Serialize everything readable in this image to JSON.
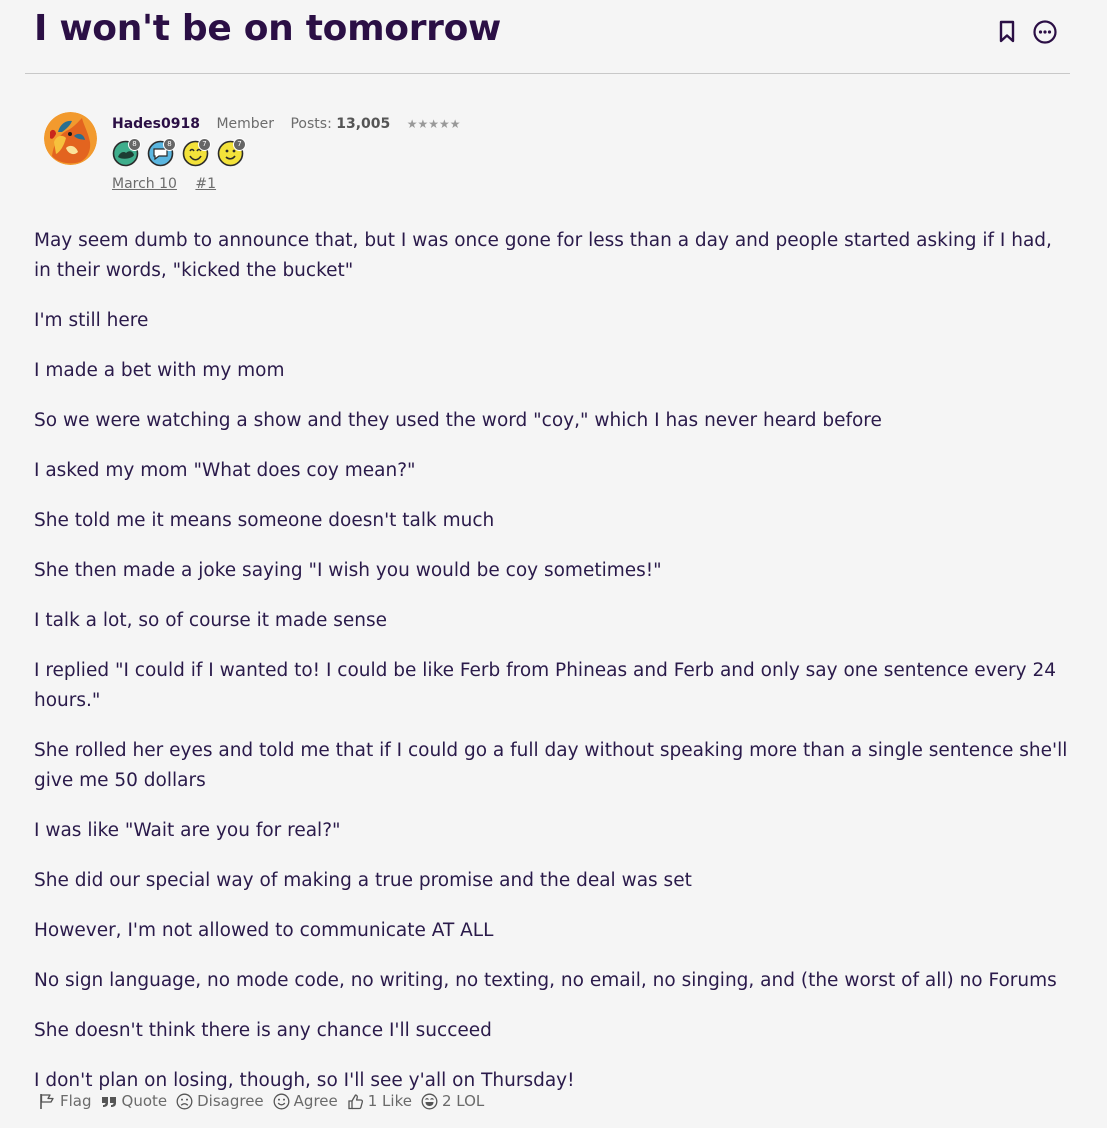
{
  "discussion": {
    "title": "I won't be on tomorrow"
  },
  "author": {
    "username": "Hades0918",
    "role": "Member",
    "posts_label": "Posts:",
    "posts_count": "13,005",
    "rank_stars": "★★★★★",
    "badges": [
      {
        "name": "badge-1",
        "count": "8",
        "color": "#3fae8c"
      },
      {
        "name": "badge-2",
        "count": "8",
        "color": "#5ab6e0"
      },
      {
        "name": "badge-3",
        "count": "7",
        "color": "#f3e23a"
      },
      {
        "name": "badge-4",
        "count": "7",
        "color": "#f3e23a"
      }
    ]
  },
  "post": {
    "date": "March 10",
    "permalink": "#1",
    "paragraphs": [
      "May seem dumb to announce that, but I was once gone for less than a day and people started asking if I had, in their words, \"kicked the bucket\"",
      "I'm still here",
      "I made a bet with my mom",
      "So we were watching a show and they used the word \"coy,\" which I has never heard before",
      "I asked my mom \"What does coy mean?\"",
      "She told me it means someone doesn't talk much",
      "She then made a joke saying \"I wish you would be coy sometimes!\"",
      "I talk a lot, so of course it made sense",
      "I replied \"I could if I wanted to! I could be like Ferb from Phineas and Ferb and only say one sentence every 24 hours.\"",
      "She rolled her eyes and told me that if I could go a full day without speaking more than a single sentence she'll give me 50 dollars",
      "I was like \"Wait are you for real?\"",
      "She did our special way of making a true promise and the deal was set",
      "However, I'm not allowed to communicate AT ALL",
      "No sign language, no mode code, no writing, no texting, no email, no singing, and (the worst of all) no Forums",
      "She doesn't think there is any chance I'll succeed",
      "I don't plan on losing, though, so I'll see y'all on Thursday!"
    ]
  },
  "reactions": {
    "flag": "Flag",
    "quote": "Quote",
    "disagree": "Disagree",
    "agree": "Agree",
    "like": "1 Like",
    "lol": "2 LOL"
  }
}
